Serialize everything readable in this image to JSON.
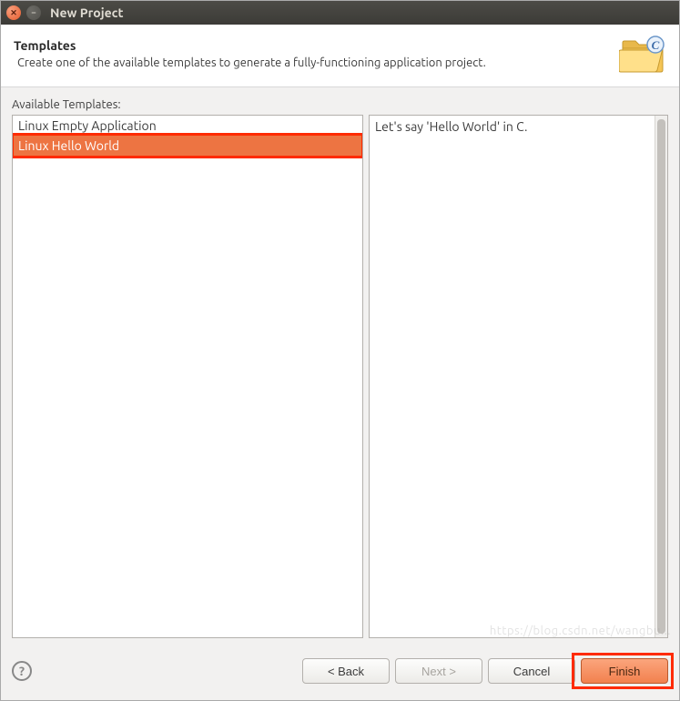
{
  "window": {
    "title": "New Project"
  },
  "banner": {
    "title": "Templates",
    "description": "Create one of the available templates to generate a fully-functioning application project."
  },
  "content": {
    "available_label": "Available Templates:",
    "templates": [
      {
        "label": "Linux Empty Application",
        "selected": false
      },
      {
        "label": "Linux Hello World",
        "selected": true
      }
    ],
    "description": "Let's say 'Hello World' in C."
  },
  "footer": {
    "help": "?",
    "back": "< Back",
    "next": "Next >",
    "cancel": "Cancel",
    "finish": "Finish"
  },
  "watermark": "https://blog.csdn.net/wangbu..."
}
